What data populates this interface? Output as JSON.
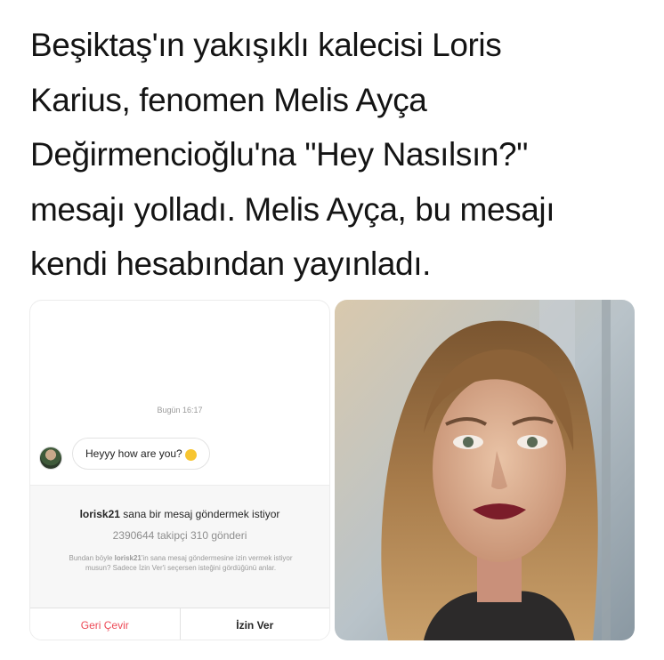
{
  "headline": {
    "lines": [
      "Beşiktaş'ın yakışıklı kalecisi Loris",
      "Karius, fenomen Melis Ayça",
      "Değirmencioğlu'na \"Hey Nasılsın?\"",
      "mesajı yolladı. Melis Ayça, bu mesajı",
      "kendi hesabından yayınladı."
    ]
  },
  "dm": {
    "timestamp": "Bugün 16:17",
    "message": "Heyyy how are you?",
    "request": {
      "username": "lorisk21",
      "title_suffix": " sana bir mesaj göndermek istiyor",
      "stats": "2390644 takipçi 310 gönderi",
      "note_prefix": "Bundan böyle ",
      "note_user": "lorisk21",
      "note_suffix": "'in sana mesaj göndermesine izin vermek istiyor musun? Sadece İzin Ver'i seçersen isteğini gördüğünü anlar."
    },
    "reject_label": "Geri Çevir",
    "accept_label": "İzin Ver"
  },
  "colors": {
    "reject": "#ed4956",
    "emoji": "#f7c531"
  }
}
